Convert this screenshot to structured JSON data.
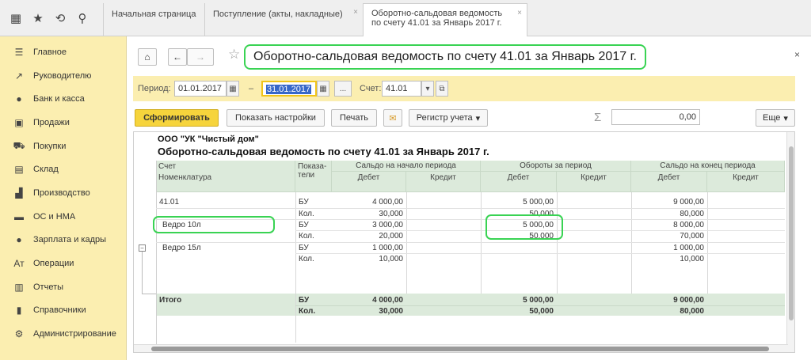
{
  "tabs": [
    {
      "label": "Начальная страница"
    },
    {
      "label": "Поступление (акты, накладные)"
    },
    {
      "label_line1": "Оборотно-сальдовая ведомость",
      "label_line2": "по счету 41.01 за Январь 2017 г."
    }
  ],
  "tab_close": "×",
  "sidebar": {
    "items": [
      {
        "label": "Главное",
        "icon": "menu-icon"
      },
      {
        "label": "Руководителю",
        "icon": "chart-icon"
      },
      {
        "label": "Банк и касса",
        "icon": "coin-icon"
      },
      {
        "label": "Продажи",
        "icon": "bag-icon"
      },
      {
        "label": "Покупки",
        "icon": "cart-icon"
      },
      {
        "label": "Склад",
        "icon": "warehouse-icon"
      },
      {
        "label": "Производство",
        "icon": "factory-icon"
      },
      {
        "label": "ОС и НМА",
        "icon": "truck-icon"
      },
      {
        "label": "Зарплата и кадры",
        "icon": "person-icon"
      },
      {
        "label": "Операции",
        "icon": "operations-icon"
      },
      {
        "label": "Отчеты",
        "icon": "reports-icon"
      },
      {
        "label": "Справочники",
        "icon": "books-icon"
      },
      {
        "label": "Администрирование",
        "icon": "gear-icon"
      }
    ]
  },
  "header": {
    "title": "Оборотно-сальдовая ведомость по счету 41.01 за Январь 2017 г.",
    "close": "×"
  },
  "period": {
    "label": "Период:",
    "from": "01.01.2017",
    "dash": "–",
    "to": "31.01.2017",
    "more": "...",
    "account_label": "Счет:",
    "account": "41.01"
  },
  "toolbar": {
    "generate": "Сформировать",
    "show_settings": "Показать настройки",
    "print": "Печать",
    "register": "Регистр учета",
    "sigma": "Σ",
    "sum_value": "0,00",
    "more": "Еще"
  },
  "report": {
    "org": "ООО \"УК \"Чистый дом\"",
    "title": "Оборотно-сальдовая ведомость по счету 41.01 за Январь 2017 г.",
    "headers": {
      "account": "Счет",
      "nomenclature": "Номенклатура",
      "indicators_1": "Показа-",
      "indicators_2": "тели",
      "opening": "Сальдо на начало периода",
      "turnover": "Обороты за период",
      "closing": "Сальдо на конец периода",
      "debit": "Дебет",
      "credit": "Кредит"
    },
    "rows": [
      {
        "name": "41.01",
        "ind": "БУ",
        "od": "4 000,00",
        "oc": "",
        "td": "5 000,00",
        "tc": "",
        "cd": "9 000,00",
        "cc": ""
      },
      {
        "name": "",
        "ind": "Кол.",
        "od": "30,000",
        "oc": "",
        "td": "50,000",
        "tc": "",
        "cd": "80,000",
        "cc": ""
      },
      {
        "name": "Ведро 10л",
        "ind": "БУ",
        "od": "3 000,00",
        "oc": "",
        "td": "5 000,00",
        "tc": "",
        "cd": "8 000,00",
        "cc": ""
      },
      {
        "name": "",
        "ind": "Кол.",
        "od": "20,000",
        "oc": "",
        "td": "50,000",
        "tc": "",
        "cd": "70,000",
        "cc": ""
      },
      {
        "name": "Ведро 15л",
        "ind": "БУ",
        "od": "1 000,00",
        "oc": "",
        "td": "",
        "tc": "",
        "cd": "1 000,00",
        "cc": ""
      },
      {
        "name": "",
        "ind": "Кол.",
        "od": "10,000",
        "oc": "",
        "td": "",
        "tc": "",
        "cd": "10,000",
        "cc": ""
      },
      {
        "name": "Итого",
        "ind": "БУ",
        "od": "4 000,00",
        "oc": "",
        "td": "5 000,00",
        "tc": "",
        "cd": "9 000,00",
        "cc": ""
      },
      {
        "name": "",
        "ind": "Кол.",
        "od": "30,000",
        "oc": "",
        "td": "50,000",
        "tc": "",
        "cd": "80,000",
        "cc": ""
      }
    ]
  }
}
